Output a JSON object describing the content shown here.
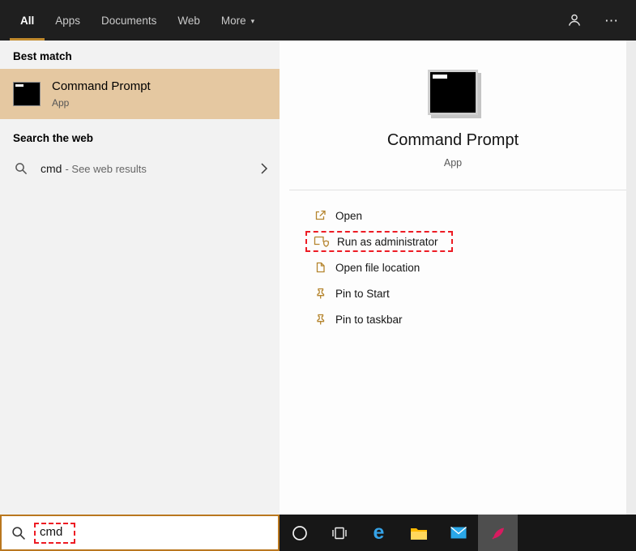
{
  "header": {
    "tabs": [
      {
        "label": "All",
        "selected": true
      },
      {
        "label": "Apps",
        "selected": false
      },
      {
        "label": "Documents",
        "selected": false
      },
      {
        "label": "Web",
        "selected": false
      },
      {
        "label": "More",
        "selected": false,
        "caret": "▾"
      }
    ],
    "ellipsis": "⋯"
  },
  "left_panel": {
    "best_match_label": "Best match",
    "best_match_item": {
      "title": "Command Prompt",
      "subtitle": "App"
    },
    "search_web_label": "Search the web",
    "web_result": {
      "query": "cmd",
      "suffix": " - See web results"
    }
  },
  "search_box": {
    "value": "cmd"
  },
  "right_panel": {
    "app_title": "Command Prompt",
    "app_subtitle": "App",
    "actions": [
      {
        "label": "Open",
        "annotated": false
      },
      {
        "label": "Run as administrator",
        "annotated": true
      },
      {
        "label": "Open file location",
        "annotated": false
      },
      {
        "label": "Pin to Start",
        "annotated": false
      },
      {
        "label": "Pin to taskbar",
        "annotated": false
      }
    ]
  },
  "taskbar": {
    "buttons": [
      "cortana",
      "task-view",
      "edge",
      "file-explorer",
      "mail",
      "active-app"
    ]
  },
  "icons": {
    "edge_glyph": "e"
  },
  "colors": {
    "accent": "#c08a2d",
    "best_match_highlight": "#e5c8a1",
    "annotation_red": "#ed1c24",
    "search_border": "#b9771f",
    "header_bg": "#1f1f1f",
    "taskbar_bg": "#171717"
  }
}
